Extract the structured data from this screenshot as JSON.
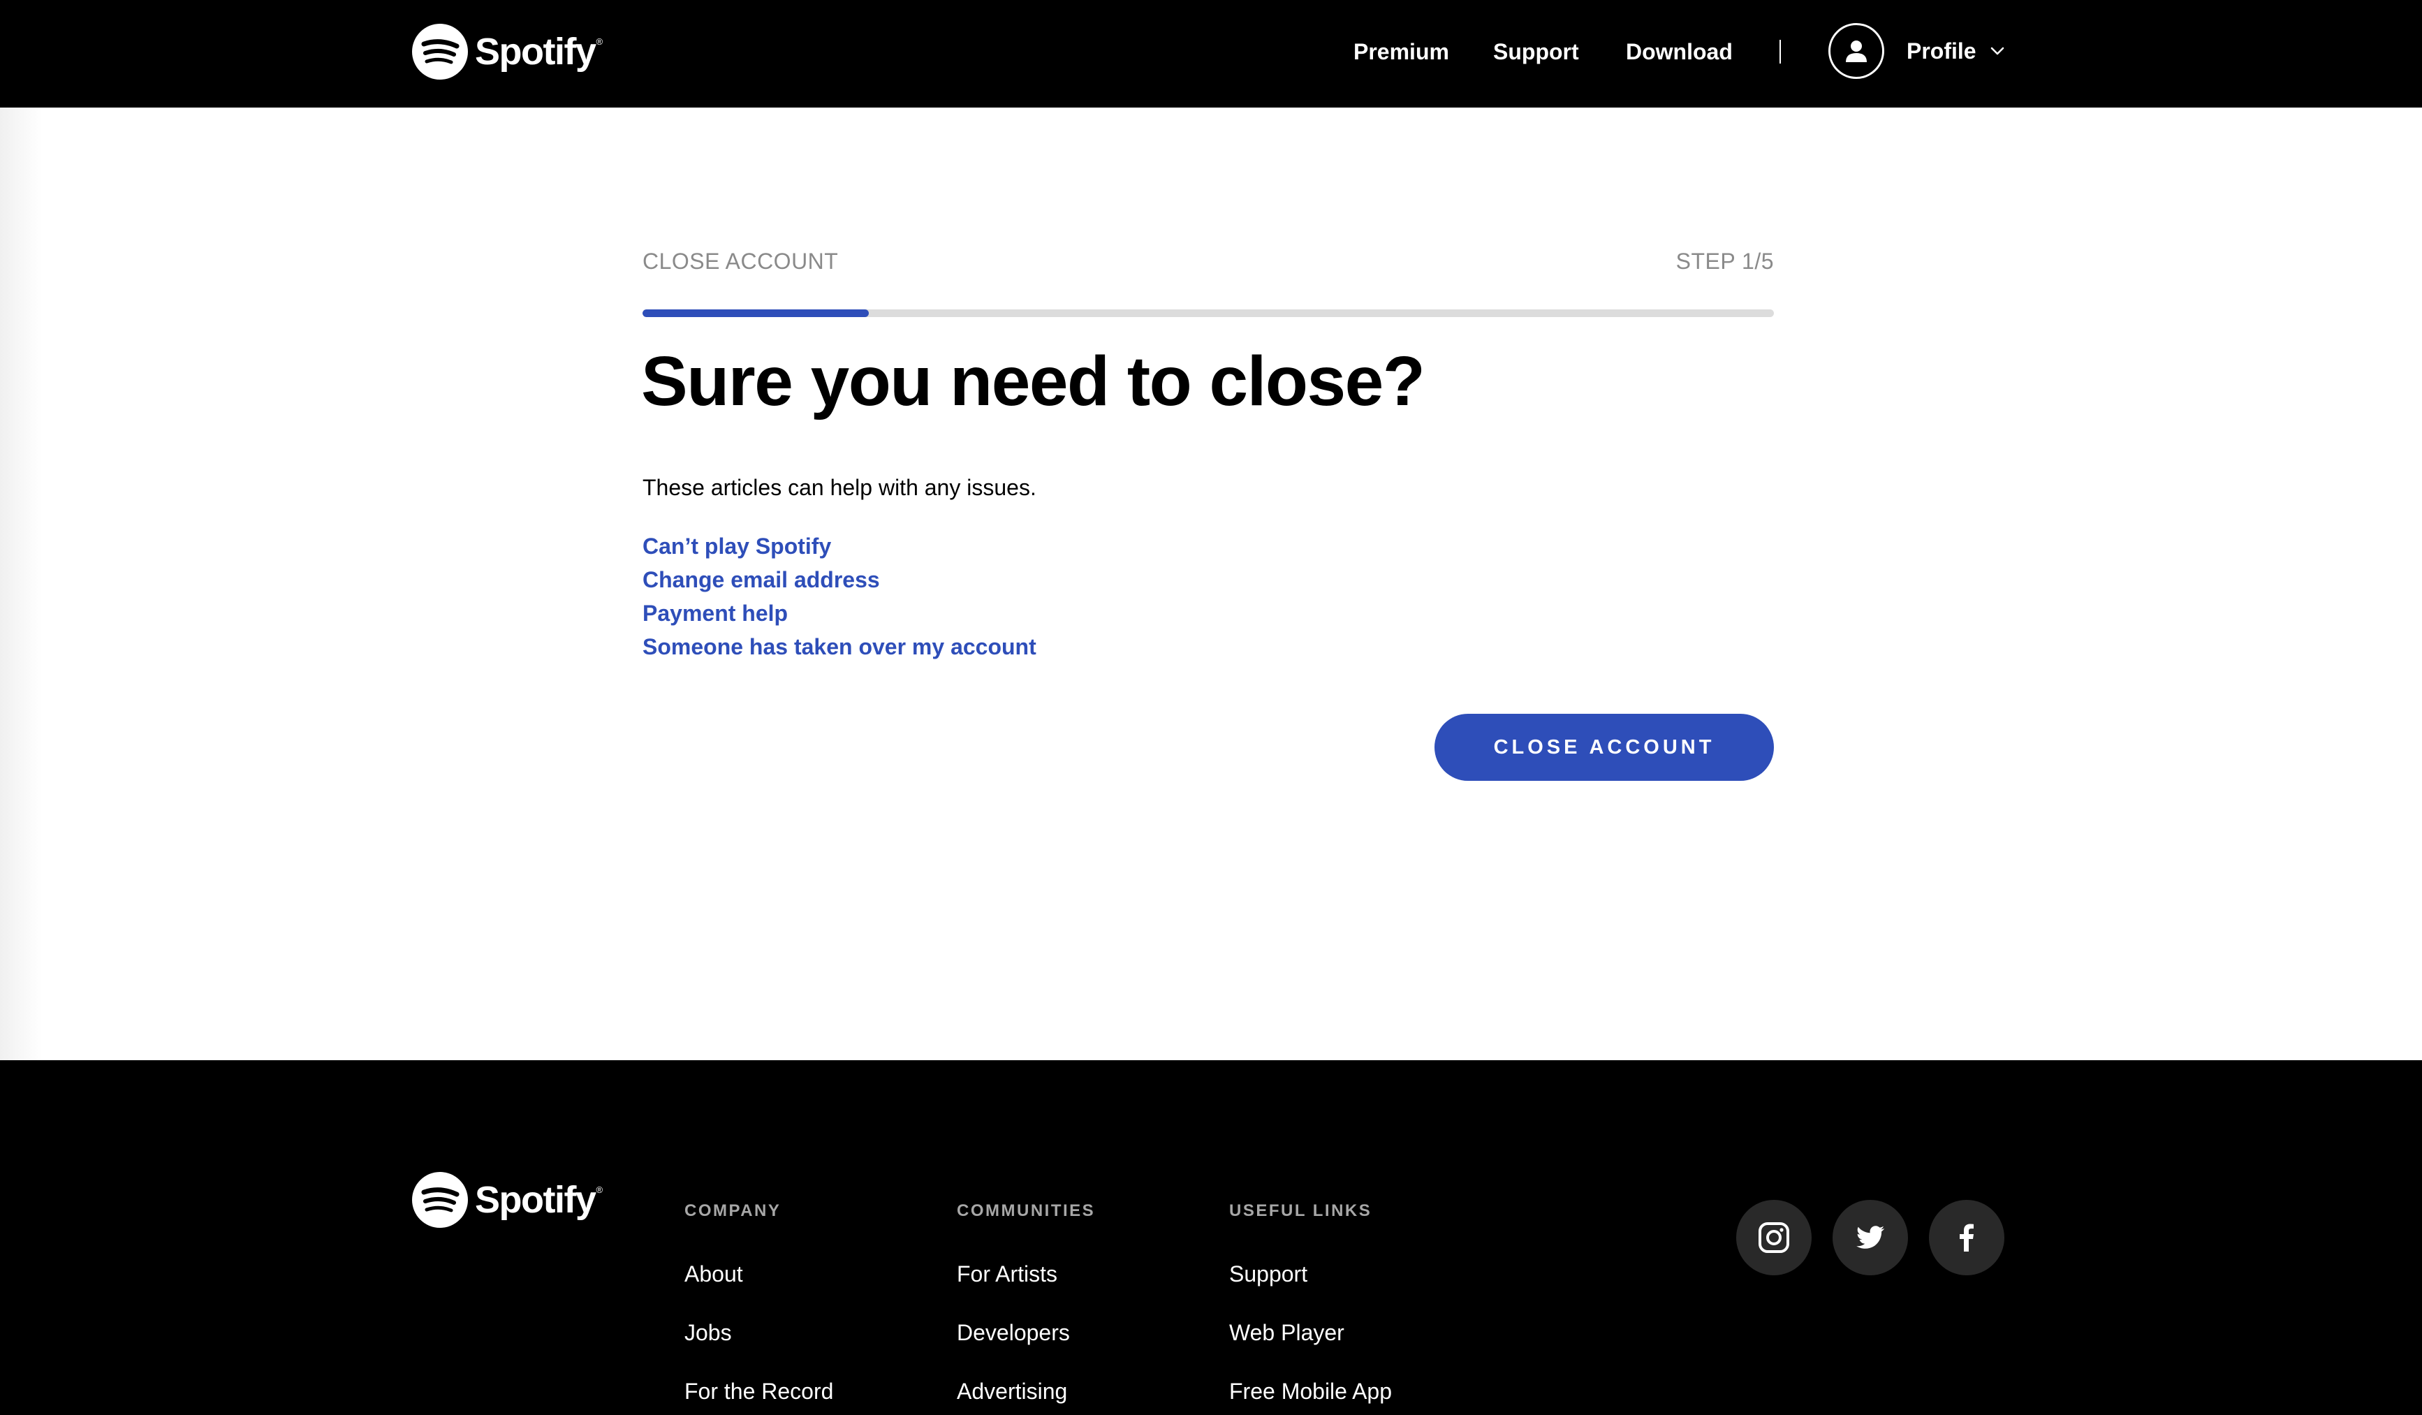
{
  "brand": {
    "name": "Spotify",
    "trademark": "®"
  },
  "header": {
    "nav": [
      {
        "label": "Premium"
      },
      {
        "label": "Support"
      },
      {
        "label": "Download"
      }
    ],
    "profile_label": "Profile",
    "icons": {
      "avatar": "user-icon",
      "chevron": "chevron-down-icon"
    }
  },
  "main": {
    "flow_label": "CLOSE ACCOUNT",
    "step_label": "STEP 1/5",
    "progress_fraction": 0.2,
    "headline": "Sure you need to close?",
    "intro": "These articles can help with any issues.",
    "articles": [
      {
        "label": "Can’t play Spotify"
      },
      {
        "label": "Change email address"
      },
      {
        "label": "Payment help"
      },
      {
        "label": "Someone has taken over my account"
      }
    ],
    "close_button_label": "CLOSE ACCOUNT"
  },
  "footer": {
    "columns": [
      {
        "heading": "COMPANY",
        "items": [
          "About",
          "Jobs",
          "For the Record"
        ]
      },
      {
        "heading": "COMMUNITIES",
        "items": [
          "For Artists",
          "Developers",
          "Advertising"
        ]
      },
      {
        "heading": "USEFUL LINKS",
        "items": [
          "Support",
          "Web Player",
          "Free Mobile App"
        ]
      }
    ],
    "social": [
      {
        "icon": "instagram-icon"
      },
      {
        "icon": "twitter-icon"
      },
      {
        "icon": "facebook-icon"
      }
    ]
  },
  "colors": {
    "accent": "#2e4eb9",
    "header_bg": "#000000",
    "footer_bg": "#000000",
    "muted_text": "#8a8a8a",
    "footer_heading": "#a7a7a7",
    "social_bg": "#292929"
  }
}
